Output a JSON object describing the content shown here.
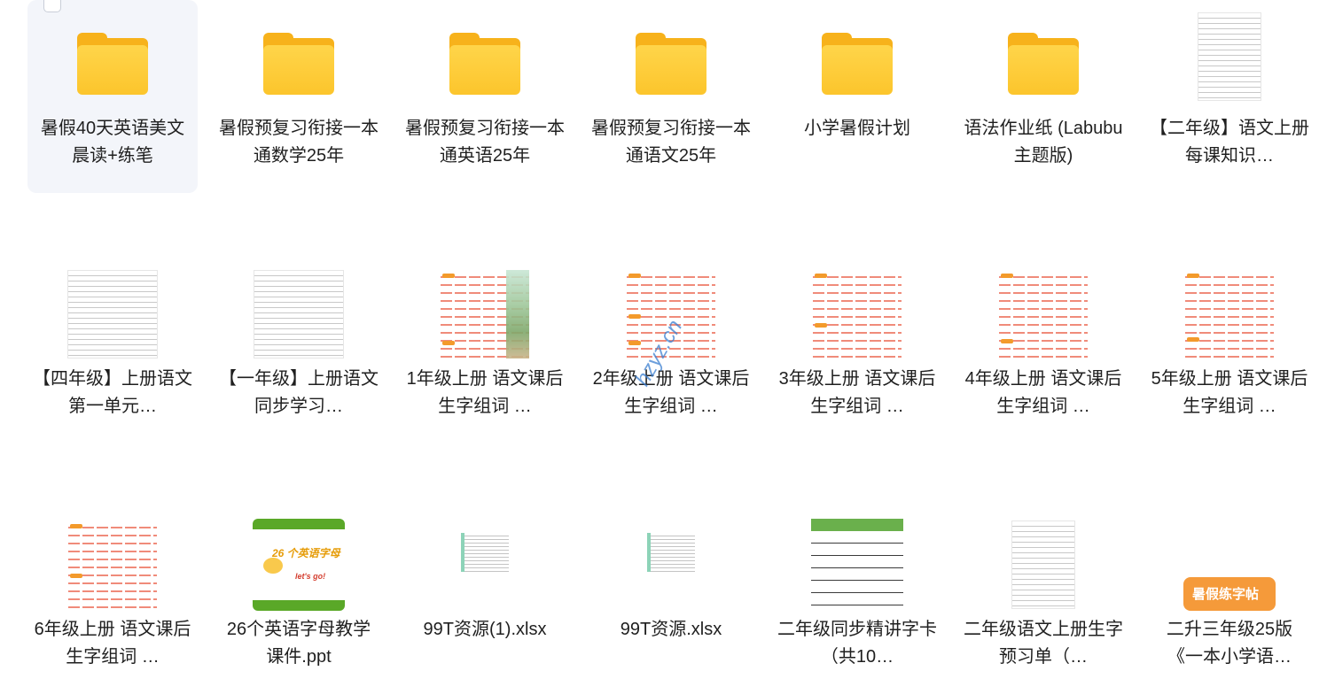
{
  "files": [
    {
      "name": "暑假40天英语美文晨读+练笔",
      "type": "folder",
      "selected": true
    },
    {
      "name": "暑假预复习衔接一本通数学25年",
      "type": "folder"
    },
    {
      "name": "暑假预复习衔接一本通英语25年",
      "type": "folder"
    },
    {
      "name": "暑假预复习衔接一本通语文25年",
      "type": "folder"
    },
    {
      "name": "小学暑假计划",
      "type": "folder"
    },
    {
      "name": "语法作业纸 (Labubu主题版)",
      "type": "folder"
    },
    {
      "name": "【二年级】语文上册每课知识…",
      "type": "document"
    },
    {
      "name": "【四年级】上册语文第一单元…",
      "type": "document"
    },
    {
      "name": "【一年级】上册语文同步学习…",
      "type": "document"
    },
    {
      "name": "1年级上册 语文课后生字组词 …",
      "type": "worksheet"
    },
    {
      "name": "2年级上册 语文课后生字组词 …",
      "type": "worksheet"
    },
    {
      "name": "3年级上册 语文课后生字组词 …",
      "type": "worksheet"
    },
    {
      "name": "4年级上册 语文课后生字组词 …",
      "type": "worksheet"
    },
    {
      "name": "5年级上册 语文课后生字组词 …",
      "type": "worksheet"
    },
    {
      "name": "6年级上册 语文课后生字组词 …",
      "type": "worksheet"
    },
    {
      "name": "26个英语字母教学课件.ppt",
      "type": "ppt",
      "thumb_title": "26 个英语字母",
      "thumb_sub": "let's go!"
    },
    {
      "name": "99T资源(1).xlsx",
      "type": "xlsx"
    },
    {
      "name": "99T资源.xlsx",
      "type": "xlsx"
    },
    {
      "name": "二年级同步精讲字卡（共10…",
      "type": "card"
    },
    {
      "name": "二年级语文上册生字预习单（…",
      "type": "document"
    },
    {
      "name": "二升三年级25版《一本小学语…",
      "type": "copybook",
      "thumb_text": "暑假练字帖"
    }
  ],
  "watermark": "hzyz.cn",
  "colors": {
    "folder": "#fcc52c",
    "selected_bg": "#f3f5fa",
    "worksheet_line": "#f08b7a"
  }
}
